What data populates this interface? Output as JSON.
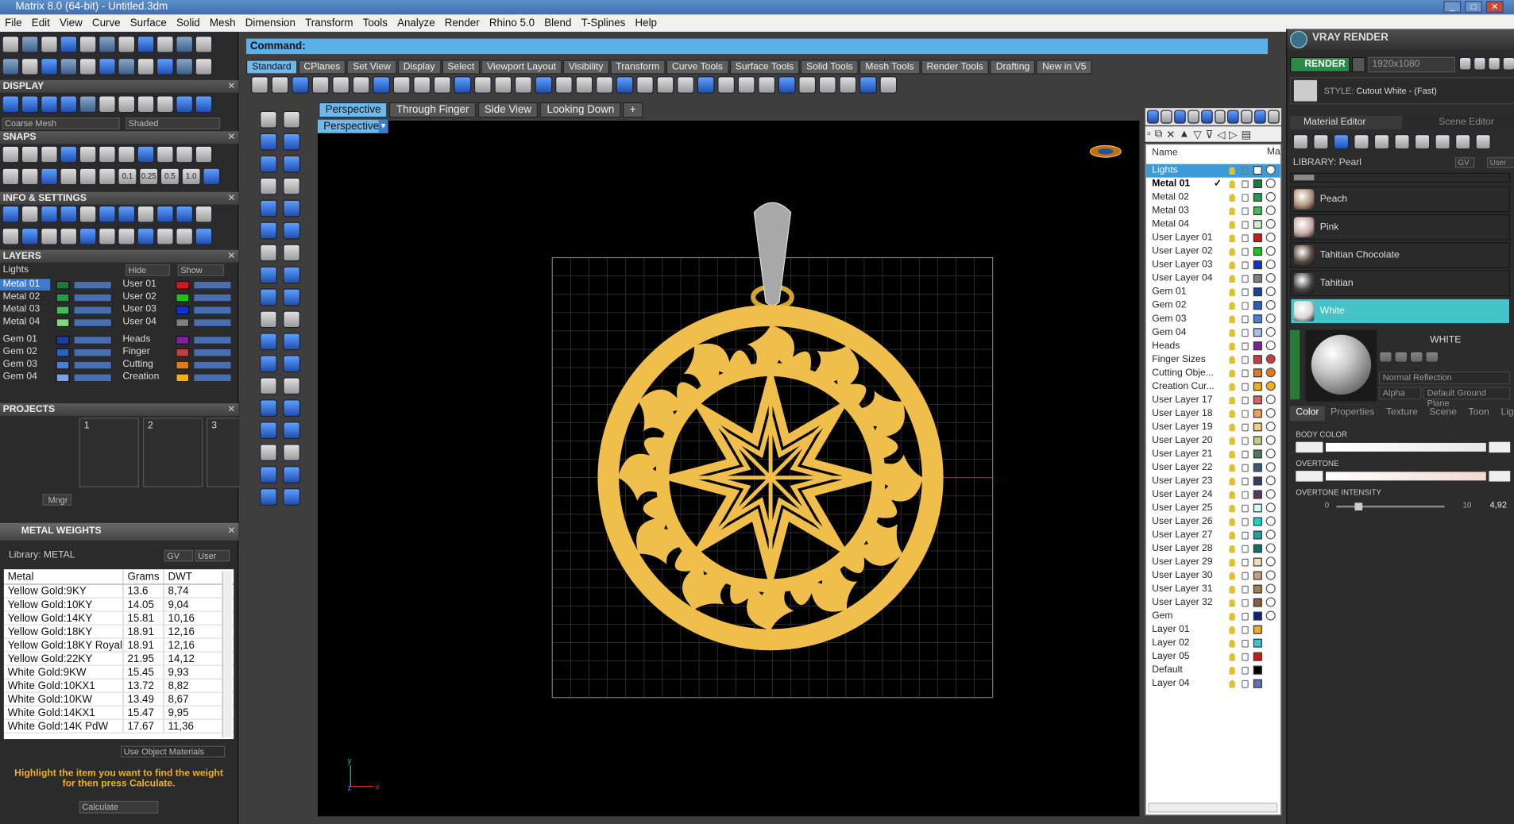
{
  "window": {
    "title": "Matrix 8.0 (64-bit) - Untitled.3dm"
  },
  "menu": [
    "File",
    "Edit",
    "View",
    "Curve",
    "Surface",
    "Solid",
    "Mesh",
    "Dimension",
    "Transform",
    "Tools",
    "Analyze",
    "Render",
    "Rhino 5.0",
    "Blend",
    "T-Splines",
    "Help"
  ],
  "left": {
    "display_title": "DISPLAY",
    "mesh_mode": "Coarse Mesh",
    "shade_mode": "Shaded",
    "snaps_title": "SNAPS",
    "snap_values": [
      "0.1",
      "0.25",
      "0.5",
      "1.0"
    ],
    "info_title": "INFO & SETTINGS",
    "layers_title": "LAYERS",
    "lights": "Lights",
    "hide": "Hide",
    "show": "Show",
    "layers_a": [
      "Metal 01",
      "Metal 02",
      "Metal 03",
      "Metal 04"
    ],
    "layers_b": [
      "User 01",
      "User 02",
      "User 03",
      "User 04"
    ],
    "layers_c": [
      "Gem 01",
      "Gem 02",
      "Gem 03",
      "Gem 04"
    ],
    "layers_d": [
      "Heads",
      "Finger",
      "Cutting",
      "Creation"
    ],
    "colors_a": [
      "#1b7a3a",
      "#2a9a4a",
      "#49b85c",
      "#7ed87e"
    ],
    "colors_b": [
      "#d01818",
      "#20c020",
      "#1030d0",
      "#808080"
    ],
    "colors_c": [
      "#1a3fa0",
      "#2a5fc0",
      "#4a7fd8",
      "#7aa0e8"
    ],
    "colors_d": [
      "#8020a0",
      "#c04040",
      "#e07a20",
      "#f0b020"
    ],
    "projects_title": "PROJECTS",
    "project_nums": [
      "1",
      "2",
      "3"
    ],
    "mgr": "Mngr",
    "metal_title": "METAL WEIGHTS",
    "library": "Library: METAL",
    "gv": "GV",
    "user": "User",
    "table_headers": [
      "Metal",
      "Grams",
      "DWT"
    ],
    "rows": [
      [
        "Yellow Gold:9KY",
        "13.6",
        "8,74"
      ],
      [
        "Yellow Gold:10KY",
        "14.05",
        "9,04"
      ],
      [
        "Yellow Gold:14KY",
        "15.81",
        "10,16"
      ],
      [
        "Yellow Gold:18KY",
        "18.91",
        "12,16"
      ],
      [
        "Yellow Gold:18KY Royal",
        "18.91",
        "12,16"
      ],
      [
        "Yellow Gold:22KY",
        "21.95",
        "14,12"
      ],
      [
        "White Gold:9KW",
        "15.45",
        "9,93"
      ],
      [
        "White Gold:10KX1",
        "13.72",
        "8,82"
      ],
      [
        "White Gold:10KW",
        "13.49",
        "8,67"
      ],
      [
        "White Gold:14KX1",
        "15.47",
        "9,95"
      ],
      [
        "White Gold:14K PdW",
        "17.67",
        "11,36"
      ]
    ],
    "use_object": "Use Object Materials",
    "hint": "Highlight the item you want to find the weight for then press Calculate.",
    "calculate": "Calculate"
  },
  "command": {
    "label": "Command:"
  },
  "tabs": [
    "Standard",
    "CPlanes",
    "Set View",
    "Display",
    "Select",
    "Viewport Layout",
    "Visibility",
    "Transform",
    "Curve Tools",
    "Surface Tools",
    "Solid Tools",
    "Mesh Tools",
    "Render Tools",
    "Drafting",
    "New in V5"
  ],
  "viewtabs": [
    "Perspective",
    "Through Finger",
    "Side View",
    "Looking Down"
  ],
  "viewport_label": "Perspective",
  "layerlist": {
    "header": "Name",
    "header_mat": "Ma",
    "items": [
      [
        "Lights",
        "#ffffff"
      ],
      [
        "Metal 01",
        "#1b7a3a"
      ],
      [
        "Metal 02",
        "#2a9a4a"
      ],
      [
        "Metal 03",
        "#49b85c"
      ],
      [
        "Metal 04",
        "#c8f0c8"
      ],
      [
        "User Layer 01",
        "#d01818"
      ],
      [
        "User Layer 02",
        "#20c020"
      ],
      [
        "User Layer 03",
        "#1030d0"
      ],
      [
        "User Layer 04",
        "#808080"
      ],
      [
        "Gem 01",
        "#1a3fa0"
      ],
      [
        "Gem 02",
        "#2a5fc0"
      ],
      [
        "Gem 03",
        "#4a7fd8"
      ],
      [
        "Gem 04",
        "#aac0f0"
      ],
      [
        "Heads",
        "#8020a0"
      ],
      [
        "Finger Sizes",
        "#c04040"
      ],
      [
        "Cutting Obje...",
        "#e07a20"
      ],
      [
        "Creation Cur...",
        "#f0b020"
      ],
      [
        "User Layer 17",
        "#e06060"
      ],
      [
        "User Layer 18",
        "#f0a060"
      ],
      [
        "User Layer 19",
        "#f0d080"
      ],
      [
        "User Layer 20",
        "#c0d080"
      ],
      [
        "User Layer 21",
        "#4a7a5a"
      ],
      [
        "User Layer 22",
        "#3a5a7a"
      ],
      [
        "User Layer 23",
        "#3a3a6a"
      ],
      [
        "User Layer 24",
        "#5a3a5a"
      ],
      [
        "User Layer 25",
        "#d0f8f8"
      ],
      [
        "User Layer 26",
        "#20d0d0"
      ],
      [
        "User Layer 27",
        "#20a0a0"
      ],
      [
        "User Layer 28",
        "#107070"
      ],
      [
        "User Layer 29",
        "#f0e0c0"
      ],
      [
        "User Layer 30",
        "#c0a080"
      ],
      [
        "User Layer 31",
        "#a08050"
      ],
      [
        "User Layer 32",
        "#806040"
      ],
      [
        "Gem",
        "#102080"
      ],
      [
        "Layer 01",
        "#f0b020"
      ],
      [
        "Layer 02",
        "#40c0d0"
      ],
      [
        "Layer 05",
        "#e01010"
      ],
      [
        "Default",
        "#000000"
      ],
      [
        "Layer 04",
        "#6070c0"
      ]
    ]
  },
  "vray": {
    "title": "VRAY RENDER",
    "render": "RENDER",
    "resolution": "1920x1080",
    "style_label": "STYLE:",
    "style": "Cutout White - (Fast)",
    "tab1": "Material Editor",
    "tab2": "Scene Editor",
    "library": "LIBRARY: Pearl",
    "gv": "GV",
    "user": "User",
    "materials": [
      "Peach",
      "Pink",
      "Tahitian Chocolate",
      "Tahitian",
      "White"
    ],
    "mat_colors": [
      "#b0917a",
      "#c9aaa6",
      "#5a4a40",
      "#454545",
      "#d8d8d8"
    ],
    "preview_name": "WHITE",
    "reflection": "Normal Reflection",
    "alpha": "Alpha",
    "ground": "Default Ground Plane",
    "subtabs": [
      "Color",
      "Properties",
      "Texture",
      "Scene",
      "Toon",
      "Ligh"
    ],
    "body_color": "BODY COLOR",
    "overtone": "OVERTONE",
    "overtone_intensity": "OVERTONE INTENSITY",
    "oi_min": "0",
    "oi_max": "10",
    "oi_value": "4,92"
  }
}
